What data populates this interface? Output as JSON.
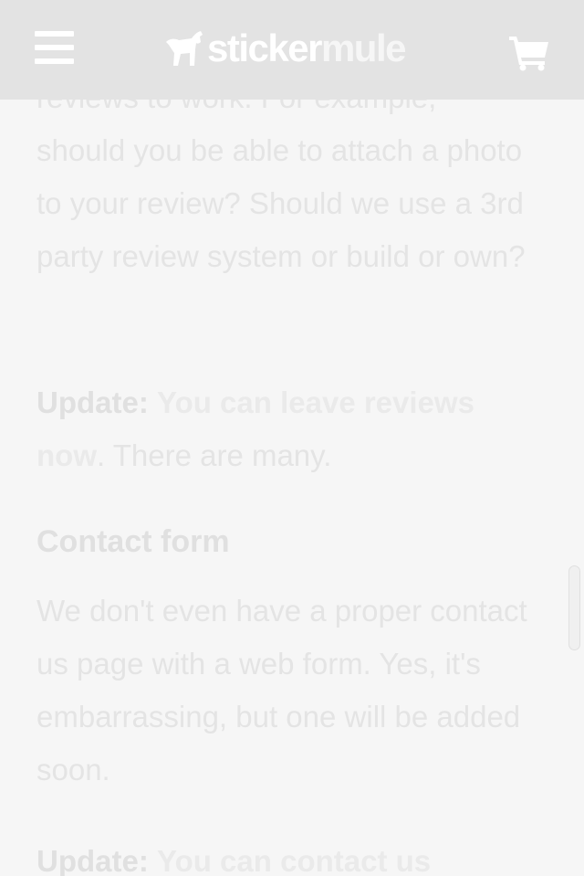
{
  "header": {
    "logo_sticker": "sticker",
    "logo_mule": "mule"
  },
  "icons": {
    "menu": "hamburger-menu-icon",
    "logo": "mule-logo-icon",
    "cart": "shopping-cart-icon"
  },
  "colors": {
    "header_bg": "#e3e3e3",
    "page_bg": "#f6f6f6",
    "text": "#e4e4e4"
  },
  "article": {
    "review_para": {
      "partial_line": "reviews to work. For example,",
      "text": "should you be able to attach a photo to your review? Should we use a 3rd party review system or build or own?"
    },
    "update1": {
      "label": "Update:",
      "link": "You can leave reviews now",
      "rest": ". There are many."
    },
    "contact_heading": "Contact form",
    "contact_para": "We don't even have a proper contact us page with a web form. Yes, it's embarrassing, but one will be added soon.",
    "update2": {
      "label": "Update:",
      "link": "You can contact us"
    }
  }
}
